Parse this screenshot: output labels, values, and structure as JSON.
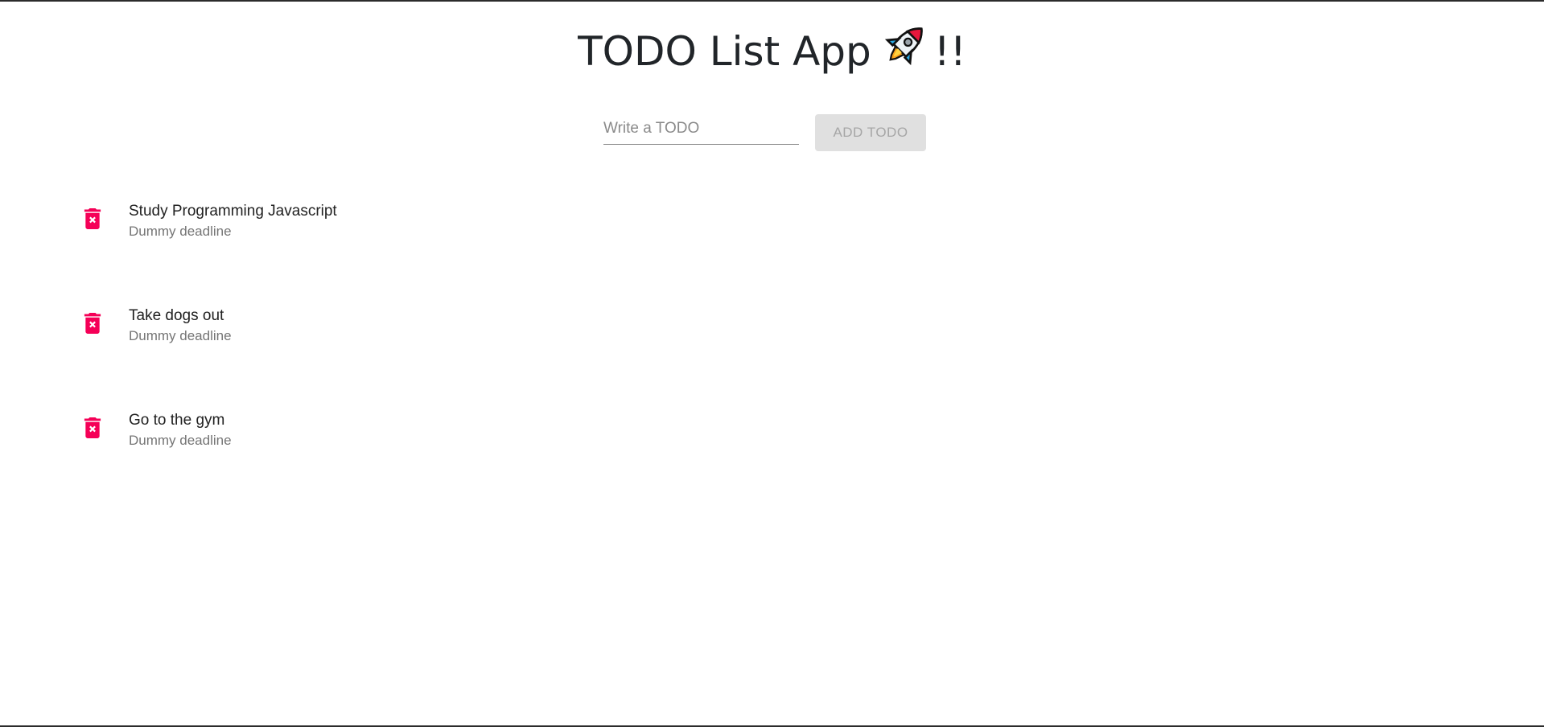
{
  "header": {
    "title": "TODO List App",
    "title_suffix": "!!",
    "rocket_icon": "rocket-icon"
  },
  "form": {
    "input_placeholder": "Write a TODO",
    "input_value": "",
    "add_button_label": "ADD TODO"
  },
  "todos": [
    {
      "title": "Study Programming Javascript",
      "deadline": "Dummy deadline",
      "icon": "delete-forever-icon"
    },
    {
      "title": "Take dogs out",
      "deadline": "Dummy deadline",
      "icon": "delete-forever-icon"
    },
    {
      "title": "Go to the gym",
      "deadline": "Dummy deadline",
      "icon": "delete-forever-icon"
    }
  ],
  "colors": {
    "delete_icon": "#f50057",
    "button_disabled_bg": "#e0e0e0",
    "button_disabled_text": "#a6a6a6"
  }
}
